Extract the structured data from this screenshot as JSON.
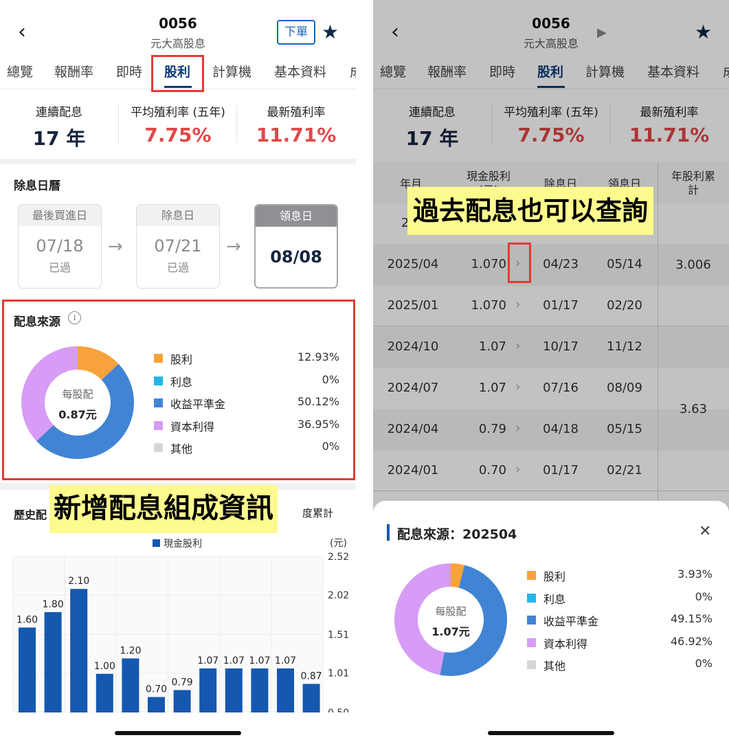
{
  "header": {
    "code": "0056",
    "name": "元大高股息",
    "order_button": "下單",
    "star_icon": "★"
  },
  "tabs": [
    "總覽",
    "報酬率",
    "即時",
    "股利",
    "計算機",
    "基本資料",
    "成"
  ],
  "active_tab": "股利",
  "stats": {
    "consecutive_label": "連續配息",
    "consecutive_value": "17 年",
    "avg_yield_label": "平均殖利率 (五年)",
    "avg_yield_value": "7.75%",
    "latest_yield_label": "最新殖利率",
    "latest_yield_value": "11.71%"
  },
  "calendar": {
    "title": "除息日曆",
    "last_buy_label": "最後買進日",
    "last_buy_date": "07/18",
    "last_buy_status": "已過",
    "ex_label": "除息日",
    "ex_date": "07/21",
    "ex_status": "已過",
    "pay_label": "領息日",
    "pay_date": "08/08"
  },
  "source": {
    "title": "配息來源",
    "center_label": "每股配",
    "center_value": "0.87元",
    "items": [
      {
        "name": "股利",
        "pct": "12.93%",
        "color": "#f7a23b"
      },
      {
        "name": "利息",
        "pct": "0%",
        "color": "#22b6e6"
      },
      {
        "name": "收益平準金",
        "pct": "50.12%",
        "color": "#4184d4"
      },
      {
        "name": "資本利得",
        "pct": "36.95%",
        "color": "#d69cf6"
      },
      {
        "name": "其他",
        "pct": "0%",
        "color": "#d6d6d6"
      }
    ]
  },
  "annotations": {
    "left": "新增配息組成資訊",
    "right": "過去配息也可以查詢"
  },
  "history": {
    "title": "歷史配",
    "right_label": "度累計",
    "legend": "現金股利",
    "unit": "(元)"
  },
  "chart_data": {
    "type": "bar",
    "series": [
      {
        "name": "現金股利",
        "values": [
          1.6,
          1.8,
          2.1,
          1.0,
          1.2,
          0.7,
          0.79,
          1.07,
          1.07,
          1.07,
          1.07,
          0.87
        ]
      }
    ],
    "labels": [
      "1.60",
      "1.80",
      "2.10",
      "1.00",
      "1.20",
      "0.70",
      "0.79",
      "1.07",
      "1.07",
      "1.07",
      "1.07",
      "0.87"
    ],
    "ylim": [
      0.5,
      2.52
    ],
    "yticks": [
      "2.52",
      "2.02",
      "1.51",
      "1.01",
      "0.50"
    ],
    "ylabel": "(元)",
    "color": "#1558b0"
  },
  "right": {
    "header_code": "0056",
    "header_name": "元大高股息",
    "table_headers": [
      "年月",
      "現金股利(元)",
      "除息日",
      "領息日",
      "年股利累計"
    ],
    "rows": [
      {
        "ym": "202",
        "cash": "",
        "ex": "",
        "pay": ""
      },
      {
        "ym": "2025/04",
        "cash": "1.070",
        "ex": "04/23",
        "pay": "05/14"
      },
      {
        "ym": "2025/01",
        "cash": "1.070",
        "ex": "01/17",
        "pay": "02/20"
      },
      {
        "ym": "2024/10",
        "cash": "1.07",
        "ex": "10/17",
        "pay": "11/12"
      },
      {
        "ym": "2024/07",
        "cash": "1.07",
        "ex": "07/16",
        "pay": "08/09"
      },
      {
        "ym": "2024/04",
        "cash": "0.79",
        "ex": "04/18",
        "pay": "05/15"
      },
      {
        "ym": "2024/01",
        "cash": "0.70",
        "ex": "01/17",
        "pay": "02/21"
      }
    ],
    "sum_2025": "3.006",
    "sum_2024": "3.63",
    "sheet": {
      "title": "配息來源：202504",
      "center_label": "每股配",
      "center_value": "1.07元",
      "items": [
        {
          "name": "股利",
          "pct": "3.93%",
          "color": "#f7a23b"
        },
        {
          "name": "利息",
          "pct": "0%",
          "color": "#22b6e6"
        },
        {
          "name": "收益平準金",
          "pct": "49.15%",
          "color": "#4184d4"
        },
        {
          "name": "資本利得",
          "pct": "46.92%",
          "color": "#d69cf6"
        },
        {
          "name": "其他",
          "pct": "0%",
          "color": "#d6d6d6"
        }
      ]
    }
  }
}
